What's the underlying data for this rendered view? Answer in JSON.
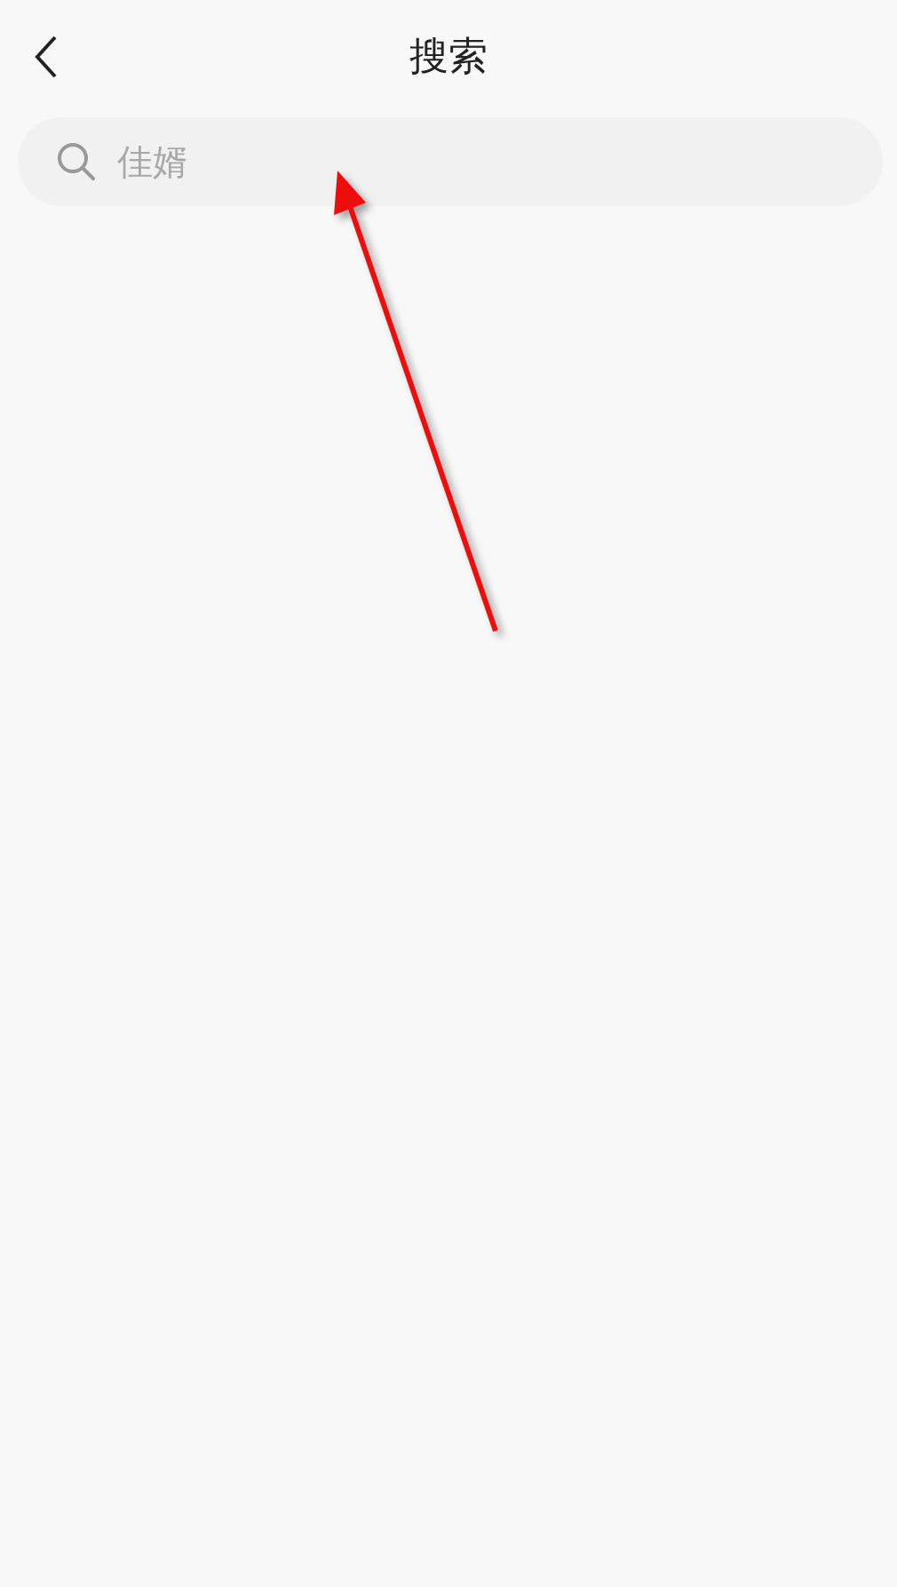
{
  "header": {
    "title": "搜索"
  },
  "search": {
    "placeholder": "佳婿"
  }
}
